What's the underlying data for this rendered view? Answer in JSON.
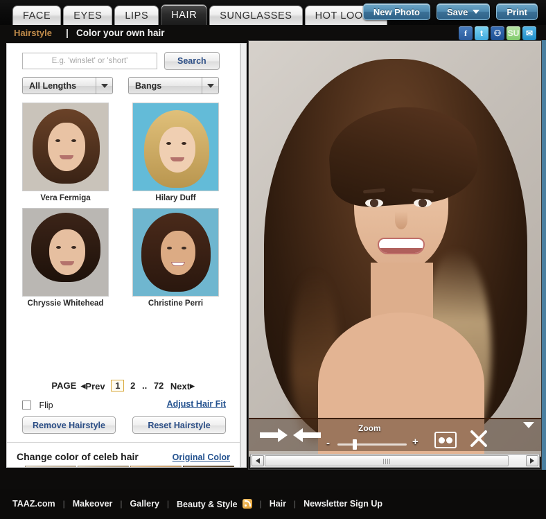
{
  "topbar": {
    "tabs": [
      {
        "label": "FACE",
        "active": false
      },
      {
        "label": "EYES",
        "active": false
      },
      {
        "label": "LIPS",
        "active": false
      },
      {
        "label": "HAIR",
        "active": true
      },
      {
        "label": "SUNGLASSES",
        "active": false
      },
      {
        "label": "HOT LOOKS",
        "active": false
      }
    ],
    "buttons": {
      "new_photo": "New Photo",
      "save": "Save",
      "print": "Print"
    }
  },
  "subheader": {
    "link": "Hairstyle",
    "separator": "|",
    "title": "Color your own hair",
    "social": [
      {
        "name": "facebook-icon",
        "glyph": "f"
      },
      {
        "name": "twitter-icon",
        "glyph": "t"
      },
      {
        "name": "myspace-icon",
        "glyph": "⚇"
      },
      {
        "name": "stumbleupon-icon",
        "glyph": "SU"
      },
      {
        "name": "email-icon",
        "glyph": "✉"
      }
    ]
  },
  "left_panel": {
    "search": {
      "placeholder": "E.g. 'winslet' or 'short'",
      "value": "",
      "button": "Search"
    },
    "filters": [
      {
        "name": "length-filter",
        "value": "All Lengths"
      },
      {
        "name": "bangs-filter",
        "value": "Bangs"
      }
    ],
    "thumbnails": [
      {
        "caption": "Vera Fermiga",
        "hair": "#4a2e1d",
        "skin": "#e9c3a4",
        "bg": "#c9c3ba"
      },
      {
        "caption": "Hilary Duff",
        "hair": "#c9a85f",
        "skin": "#f0cfb2",
        "bg": "#63bbd8"
      },
      {
        "caption": "Chryssie Whitehead",
        "hair": "#2a1a12",
        "skin": "#e6bfa0",
        "bg": "#b9b6b2"
      },
      {
        "caption": "Christine Perri",
        "hair": "#3a2216",
        "skin": "#dcab84",
        "bg": "#6fb6cf"
      }
    ],
    "pagination": {
      "label": "PAGE",
      "prev": "Prev",
      "next": "Next",
      "pages": [
        "1",
        "2"
      ],
      "ellipsis": "..",
      "last": "72",
      "current": "1"
    },
    "flip": {
      "label": "Flip",
      "checked": false
    },
    "adjust_link": "Adjust Hair Fit",
    "actions": {
      "remove": "Remove Hairstyle",
      "reset": "Reset Hairstyle"
    },
    "color_section": {
      "title": "Change color of celeb hair",
      "original_link": "Original Color",
      "swatches": [
        "#d9cbb4",
        "#cfbb9b",
        "#e7bb85",
        "#7a6243",
        "#a0623a",
        "#b5512a",
        "#6d4526",
        "#8f3c28"
      ],
      "prev_arrow": "left-arrow",
      "next_arrow": "right-arrow"
    }
  },
  "photo_tools": {
    "back": "back-arrow",
    "forward": "forward-arrow",
    "zoom_label": "Zoom",
    "minus": "-",
    "plus": "+",
    "zoom_value": 22,
    "compare": "compare-icon",
    "close": "close-icon",
    "collapse": "collapse-caret"
  },
  "footer": {
    "items": [
      {
        "label": "TAAZ.com",
        "rss": false
      },
      {
        "label": "Makeover",
        "rss": false
      },
      {
        "label": "Gallery",
        "rss": false
      },
      {
        "label": "Beauty & Style",
        "rss": true
      },
      {
        "label": "Hair",
        "rss": false
      },
      {
        "label": "Newsletter Sign Up",
        "rss": false
      }
    ]
  }
}
